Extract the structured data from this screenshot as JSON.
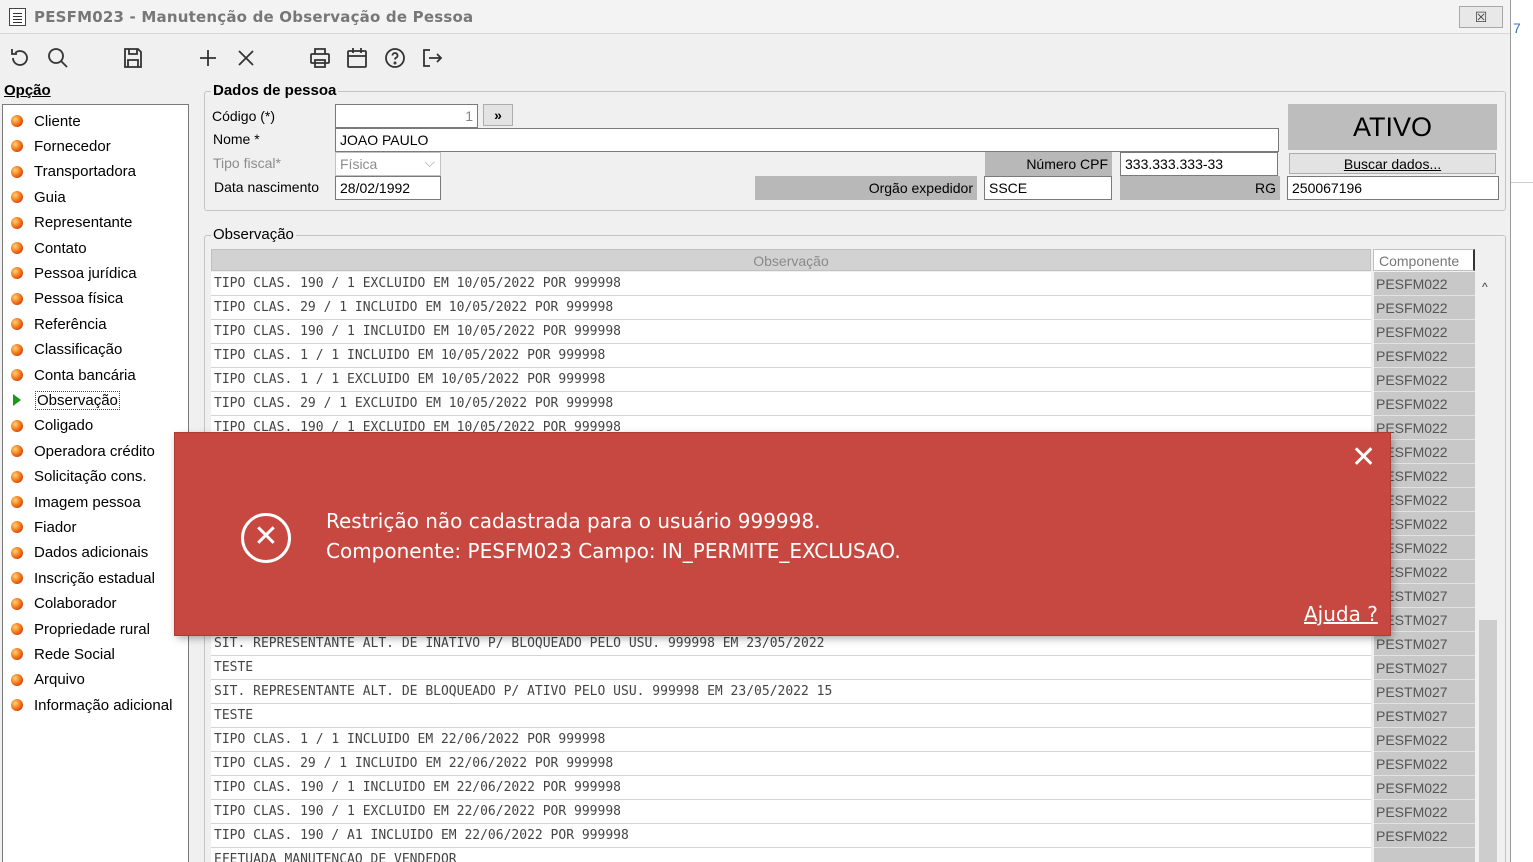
{
  "window": {
    "title": "PESFM023 - Manutenção de Observação de Pessoa",
    "close_label": "☒",
    "edge_fragment": "7"
  },
  "toolbar": {
    "buttons": [
      {
        "icon": "undo-icon"
      },
      {
        "icon": "search-icon"
      },
      {
        "icon": "save-icon"
      },
      {
        "icon": "add-icon"
      },
      {
        "icon": "delete-icon"
      },
      {
        "icon": "print-icon"
      },
      {
        "icon": "calendar-icon"
      },
      {
        "icon": "help-icon"
      },
      {
        "icon": "exit-icon"
      }
    ]
  },
  "sidebar": {
    "header": "Opção",
    "items": [
      {
        "label": "Cliente"
      },
      {
        "label": "Fornecedor"
      },
      {
        "label": "Transportadora"
      },
      {
        "label": "Guia"
      },
      {
        "label": "Representante"
      },
      {
        "label": "Contato"
      },
      {
        "label": "Pessoa jurídica"
      },
      {
        "label": "Pessoa física"
      },
      {
        "label": "Referência"
      },
      {
        "label": "Classificação"
      },
      {
        "label": "Conta bancária"
      },
      {
        "label": "Observação"
      },
      {
        "label": "Coligado"
      },
      {
        "label": "Operadora crédito"
      },
      {
        "label": "Solicitação cons."
      },
      {
        "label": "Imagem pessoa"
      },
      {
        "label": "Fiador"
      },
      {
        "label": "Dados adicionais"
      },
      {
        "label": "Inscrição estadual"
      },
      {
        "label": "Colaborador"
      },
      {
        "label": "Propriedade rural"
      },
      {
        "label": "Rede Social"
      },
      {
        "label": "Arquivo"
      },
      {
        "label": "Informação adicional"
      }
    ],
    "active_index": 11
  },
  "pessoa": {
    "group_title": "Dados de pessoa",
    "codigo_label": "Código (*)",
    "codigo_value": "1",
    "codigo_btn": "»",
    "nome_label": "Nome *",
    "nome_value": "JOAO PAULO",
    "tipo_fiscal_label": "Tipo fiscal*",
    "tipo_fiscal_value": "Física",
    "data_nasc_label": "Data nascimento",
    "data_nasc_value": "28/02/1992",
    "cpf_label": "Número CPF",
    "cpf_value": "333.333.333-33",
    "orgao_label": "Orgão expedidor",
    "orgao_value": "SSCE",
    "rg_label": "RG",
    "rg_value": "250067196",
    "status": "ATIVO",
    "buscar_label": "Buscar dados..."
  },
  "observacao": {
    "group_title": "Observação",
    "col_obs": "Observação",
    "col_comp": "Componente",
    "rows": [
      {
        "obs": "TIPO CLAS. 190 / 1 EXCLUIDO EM 10/05/2022 POR 999998",
        "comp": "PESFM022"
      },
      {
        "obs": "TIPO CLAS. 29 / 1 INCLUIDO EM 10/05/2022 POR 999998",
        "comp": "PESFM022"
      },
      {
        "obs": "TIPO CLAS. 190 / 1 INCLUIDO EM 10/05/2022 POR 999998",
        "comp": "PESFM022"
      },
      {
        "obs": "TIPO CLAS. 1 / 1 INCLUIDO EM 10/05/2022 POR 999998",
        "comp": "PESFM022"
      },
      {
        "obs": "TIPO CLAS. 1 / 1 EXCLUIDO EM 10/05/2022 POR 999998",
        "comp": "PESFM022"
      },
      {
        "obs": "TIPO CLAS. 29 / 1 EXCLUIDO EM 10/05/2022 POR 999998",
        "comp": "PESFM022"
      },
      {
        "obs": "TIPO CLAS. 190 / 1 EXCLUIDO EM 10/05/2022 POR 999998",
        "comp": "PESFM022"
      },
      {
        "obs": "",
        "comp": "PESFM022"
      },
      {
        "obs": "",
        "comp": "PESFM022"
      },
      {
        "obs": "",
        "comp": "PESFM022"
      },
      {
        "obs": "",
        "comp": "PESFM022"
      },
      {
        "obs": "",
        "comp": "PESFM022"
      },
      {
        "obs": "",
        "comp": "PESFM022"
      },
      {
        "obs": "",
        "comp": "PESTM027"
      },
      {
        "obs": "",
        "comp": "PESTM027"
      },
      {
        "obs": "SIT. REPRESENTANTE  ALT. DE INATIVO P/ BLOQUEADO PELO USU. 999998 EM 23/05/2022",
        "comp": "PESTM027"
      },
      {
        "obs": "TESTE",
        "comp": "PESTM027"
      },
      {
        "obs": "SIT. REPRESENTANTE  ALT. DE BLOQUEADO P/ ATIVO PELO USU. 999998 EM 23/05/2022 15",
        "comp": "PESTM027"
      },
      {
        "obs": "TESTE",
        "comp": "PESTM027"
      },
      {
        "obs": "TIPO CLAS. 1 / 1 INCLUIDO EM 22/06/2022 POR 999998",
        "comp": "PESFM022"
      },
      {
        "obs": "TIPO CLAS. 29 / 1 INCLUIDO EM 22/06/2022 POR 999998",
        "comp": "PESFM022"
      },
      {
        "obs": "TIPO CLAS. 190 / 1 INCLUIDO EM 22/06/2022 POR 999998",
        "comp": "PESFM022"
      },
      {
        "obs": "TIPO CLAS. 190 / 1 EXCLUIDO EM 22/06/2022 POR 999998",
        "comp": "PESFM022"
      },
      {
        "obs": "TIPO CLAS. 190 / A1 INCLUIDO EM 22/06/2022 POR 999998",
        "comp": "PESFM022"
      },
      {
        "obs": "EFETUADA MANUTENCAO DE VENDEDOR",
        "comp": ""
      }
    ]
  },
  "error_toast": {
    "line1": "Restrição não cadastrada para o usuário 999998.",
    "line2": "Componente: PESFM023 Campo: IN_PERMITE_EXCLUSAO.",
    "help_link": "Ajuda ?",
    "close_label": "✕",
    "error_glyph": "✕",
    "color": "#c64840"
  }
}
